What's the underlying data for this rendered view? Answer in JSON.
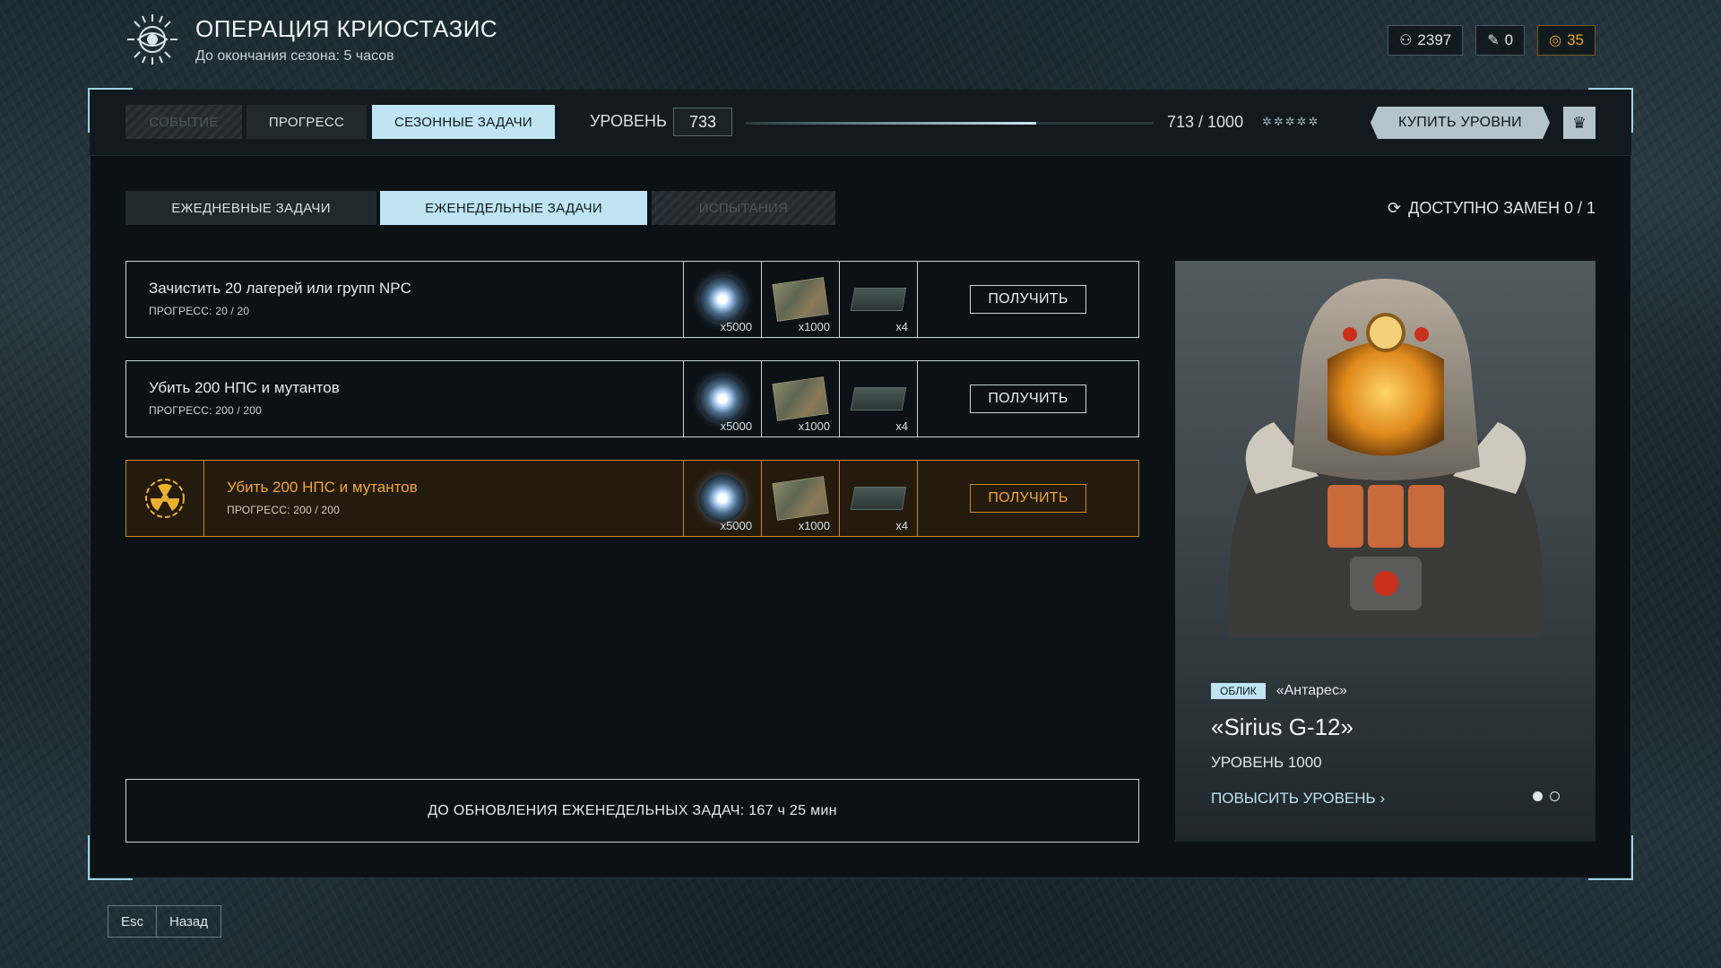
{
  "header": {
    "title": "ОПЕРАЦИЯ КРИОСТАЗИС",
    "subtitle": "До окончания сезона: 5 часов"
  },
  "currencies": [
    {
      "icon": "crowd-icon",
      "value": "2397"
    },
    {
      "icon": "ticket-icon",
      "value": "0"
    },
    {
      "icon": "gold-coin-icon",
      "value": "35",
      "color": "#e9a52c"
    }
  ],
  "tabs": {
    "event": "СОБЫТИЕ",
    "progress": "ПРОГРЕСС",
    "seasonal": "СЕЗОННЫЕ ЗАДАЧИ"
  },
  "level": {
    "label": "УРОВЕНЬ",
    "value": "733",
    "xp_text": "713 / 1000",
    "xp_fraction": 0.713,
    "stars": "✲✲✲✲✲"
  },
  "buttons": {
    "buy_levels": "КУПИТЬ УРОВНИ"
  },
  "subtabs": {
    "daily": "ЕЖЕДНЕВНЫЕ ЗАДАЧИ",
    "weekly": "ЕЖЕНЕДЕЛЬНЫЕ ЗАДАЧИ",
    "trials": "ИСПЫТАНИЯ"
  },
  "swaps": "ДОСТУПНО ЗАМЕН 0 / 1",
  "tasks": [
    {
      "title": "Зачистить 20 лагерей или групп NPC",
      "progress": "ПРОГРЕСС: 20 / 20",
      "rewards": [
        "x5000",
        "x1000",
        "x4"
      ],
      "claim": "ПОЛУЧИТЬ"
    },
    {
      "title": "Убить 200 НПС и мутантов",
      "progress": "ПРОГРЕСС: 200 / 200",
      "rewards": [
        "x5000",
        "x1000",
        "x4"
      ],
      "claim": "ПОЛУЧИТЬ"
    },
    {
      "title": "Убить 200 НПС и мутантов",
      "progress": "ПРОГРЕСС: 200 / 200",
      "rewards": [
        "x5000",
        "x1000",
        "x4"
      ],
      "claim": "ПОЛУЧИТЬ",
      "accent": "#c98a24"
    }
  ],
  "timer": "ДО ОБНОВЛЕНИЯ ЕЖЕНЕДЕЛЬНЫХ ЗАДАЧ: 167 ч 25 мин",
  "card": {
    "tag": "ОБЛИК",
    "subtitle": "«Антарес»",
    "name": "«Sirius G-12»",
    "level": "УРОВЕНЬ 1000",
    "link": "ПОВЫСИТЬ УРОВЕНЬ"
  },
  "footer": {
    "esc": "Esc",
    "back": "Назад"
  }
}
